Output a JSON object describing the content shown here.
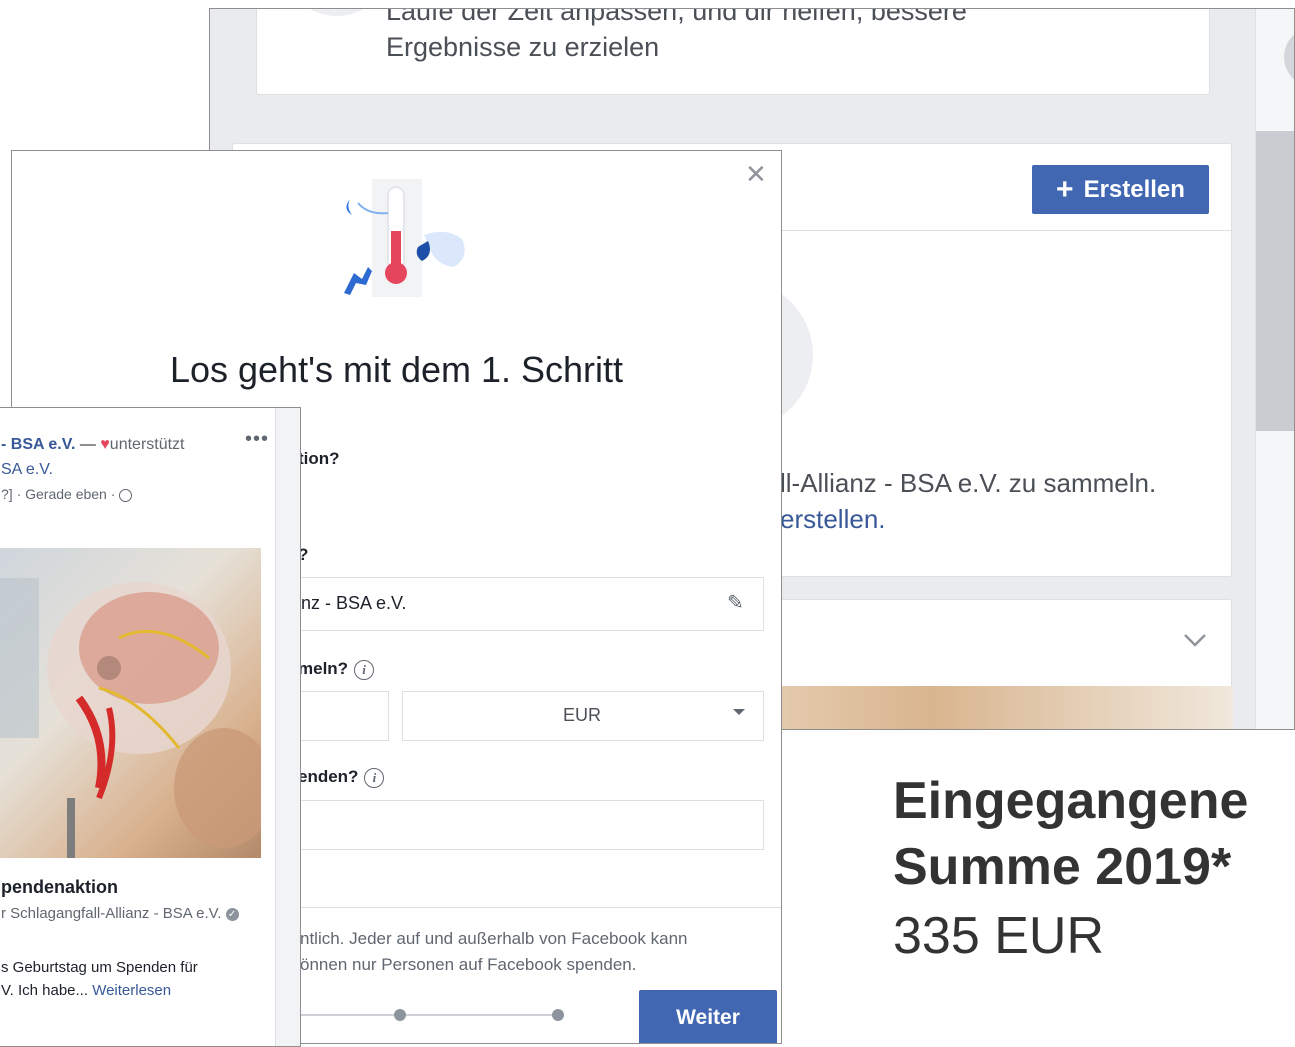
{
  "back_window": {
    "top_text_line1": "Laufe der Zeit anpassen, und dir helfen, bessere",
    "top_text_line2": "Ergebnisse zu erzielen",
    "create_button_label": "Erstellen",
    "body_text": "ll-Allianz - BSA e.V. zu sammeln.",
    "link_text": "erstellen."
  },
  "modal": {
    "title": "Los geht's mit dem 1. Schritt",
    "q1": "tion?",
    "q2": "?",
    "q2_value": "nz - BSA e.V.",
    "q3": "meln?",
    "currency_value": "EUR",
    "q4": "enden?",
    "footer_line1": "ntlich. Jeder auf und außerhalb von Facebook kann",
    "footer_line2": "önnen nur Personen auf Facebook spenden.",
    "next_button_label": "Weiter"
  },
  "post": {
    "header_line1_bold": "- BSA e.V.",
    "header_line1_rest": " — ",
    "header_line1_supported": "unterstützt",
    "header_line2": "SA e.V.",
    "header_line3": "?] · Gerade eben ·",
    "title": "pendenaktion",
    "subtitle": "r Schlagangfall-Allianz - BSA e.V.",
    "body_line1": "s Geburtstag um Spenden für",
    "body_line2": "V. Ich habe...",
    "read_more": "Weiterlesen"
  },
  "summary": {
    "label_line1": "Eingegangene",
    "label_line2": "Summe 2019*",
    "value": "335 EUR"
  },
  "colors": {
    "facebook_blue": "#4267b2",
    "link_blue": "#385898"
  }
}
